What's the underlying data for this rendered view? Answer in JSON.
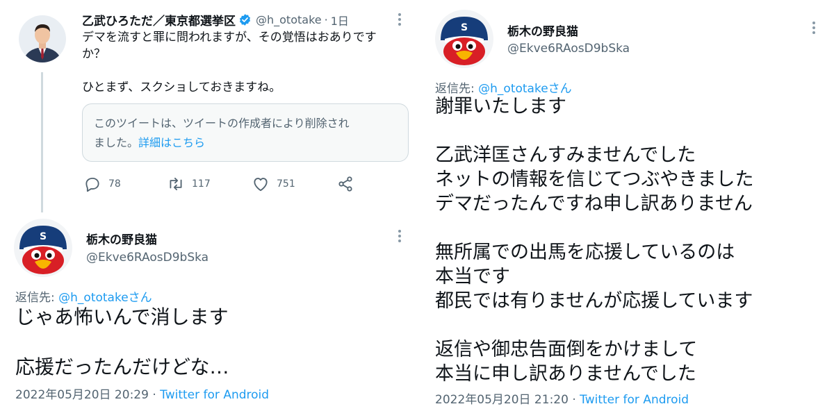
{
  "left": {
    "original_tweet": {
      "display_name": "乙武ひろただ／東京都選挙区",
      "handle": "@h_ototake",
      "separator": "·",
      "time_ago": "1日",
      "text_line1": "デマを流すと罪に問われますが、その覚悟はおありです",
      "text_line2": "か？",
      "text_line3": "ひとまず、スクショしておきますね。",
      "deleted_notice_line1": "このツイートは、ツイートの作成者により削除され",
      "deleted_notice_line2": "ました。",
      "deleted_notice_link": "詳細はこちら",
      "actions": {
        "reply_count": "78",
        "retweet_count": "117",
        "like_count": "751"
      }
    },
    "reply": {
      "display_name": "栃木の野良猫",
      "handle": "@Ekve6RAosD9bSka",
      "reply_to_prefix": "返信先: ",
      "reply_to_user": "@h_ototakeさん",
      "text_line1": "じゃあ怖いんで消します",
      "text_line2": "応援だったんだけどな…",
      "timestamp": "2022年05月20日 20:29",
      "separator": " · ",
      "source": "Twitter for Android"
    }
  },
  "right": {
    "tweet": {
      "display_name": "栃木の野良猫",
      "handle": "@Ekve6RAosD9bSka",
      "reply_to_prefix": "返信先: ",
      "reply_to_user": "@h_ototakeさん",
      "lines": [
        "謝罪いたします",
        "乙武洋匡さんすみませんでした",
        "ネットの情報を信じてつぶやきました",
        "デマだったんですね申し訳ありません",
        "無所属での出馬を応援しているのは",
        "本当です",
        "都民では有りませんが応援しています",
        "返信や御忠告面倒をかけまして",
        "本当に申し訳ありませんでした"
      ],
      "timestamp": "2022年05月20日 21:20",
      "separator": " · ",
      "source": "Twitter for Android"
    }
  },
  "colors": {
    "link_blue": "#1d9bf0",
    "secondary_text": "#536471",
    "primary_text": "#0f1419",
    "verified_blue": "#1d9bf0"
  },
  "icons": [
    "verified-badge-icon",
    "reply-icon",
    "retweet-icon",
    "like-icon",
    "share-icon",
    "more-options-icon"
  ]
}
